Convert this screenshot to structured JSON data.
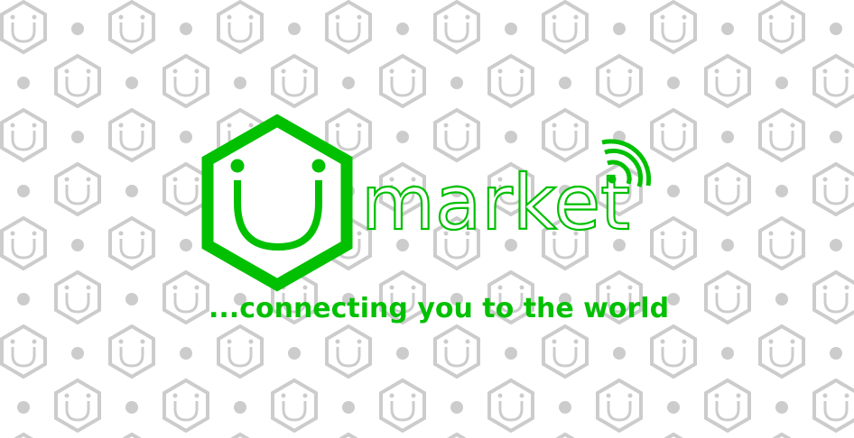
{
  "brand": {
    "name": "market",
    "tagline": "...connecting you to the world",
    "primary_color": "#00c000",
    "pattern_color": "#cccccc",
    "icons": [
      "hexagon-smile-logo",
      "wifi-signal-icon"
    ]
  }
}
